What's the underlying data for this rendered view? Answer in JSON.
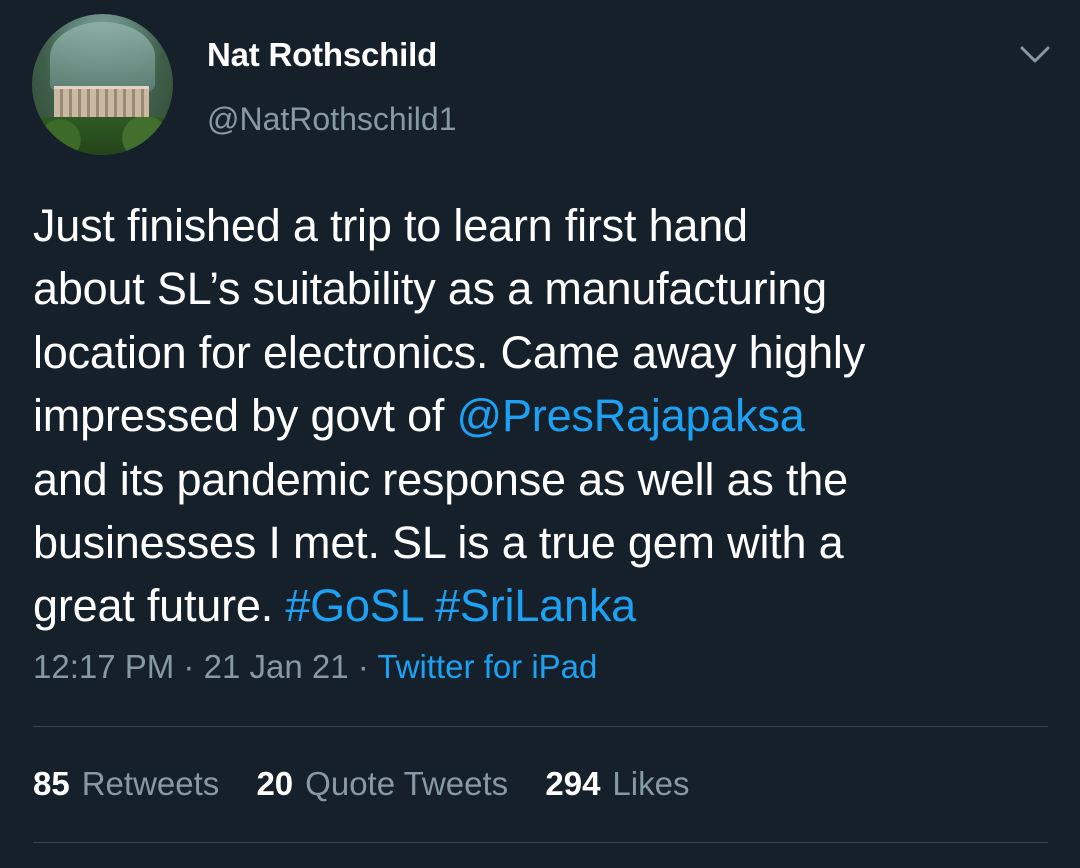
{
  "user": {
    "name": "Nat Rothschild",
    "handle": "@NatRothschild1"
  },
  "tweet": {
    "lines": [
      [
        {
          "text": "Just finished a trip to learn first hand",
          "type": "text"
        }
      ],
      [
        {
          "text": "about SL’s suitability as a manufacturing",
          "type": "text"
        }
      ],
      [
        {
          "text": "location for electronics. Came away highly",
          "type": "text"
        }
      ],
      [
        {
          "text": "impressed by govt of ",
          "type": "text"
        },
        {
          "text": "@PresRajapaksa",
          "type": "mention"
        }
      ],
      [
        {
          "text": "and its pandemic response as well as the",
          "type": "text"
        }
      ],
      [
        {
          "text": "businesses I met. SL is a true gem with a",
          "type": "text"
        }
      ],
      [
        {
          "text": "great future. ",
          "type": "text"
        },
        {
          "text": "#GoSL",
          "type": "hashtag"
        },
        {
          "text": " ",
          "type": "text"
        },
        {
          "text": "#SriLanka",
          "type": "hashtag"
        }
      ]
    ],
    "time": "12:17 PM",
    "date": "21 Jan 21",
    "separator": "·",
    "source": "Twitter for iPad"
  },
  "stats": {
    "retweets": {
      "count": "85",
      "label": "Retweets"
    },
    "quotes": {
      "count": "20",
      "label": "Quote Tweets"
    },
    "likes": {
      "count": "294",
      "label": "Likes"
    }
  },
  "colors": {
    "background": "#15202b",
    "link": "#1da1f2",
    "secondary": "#8899a6",
    "divider": "#38444d"
  },
  "icons": {
    "menu": "chevron-down-icon"
  }
}
